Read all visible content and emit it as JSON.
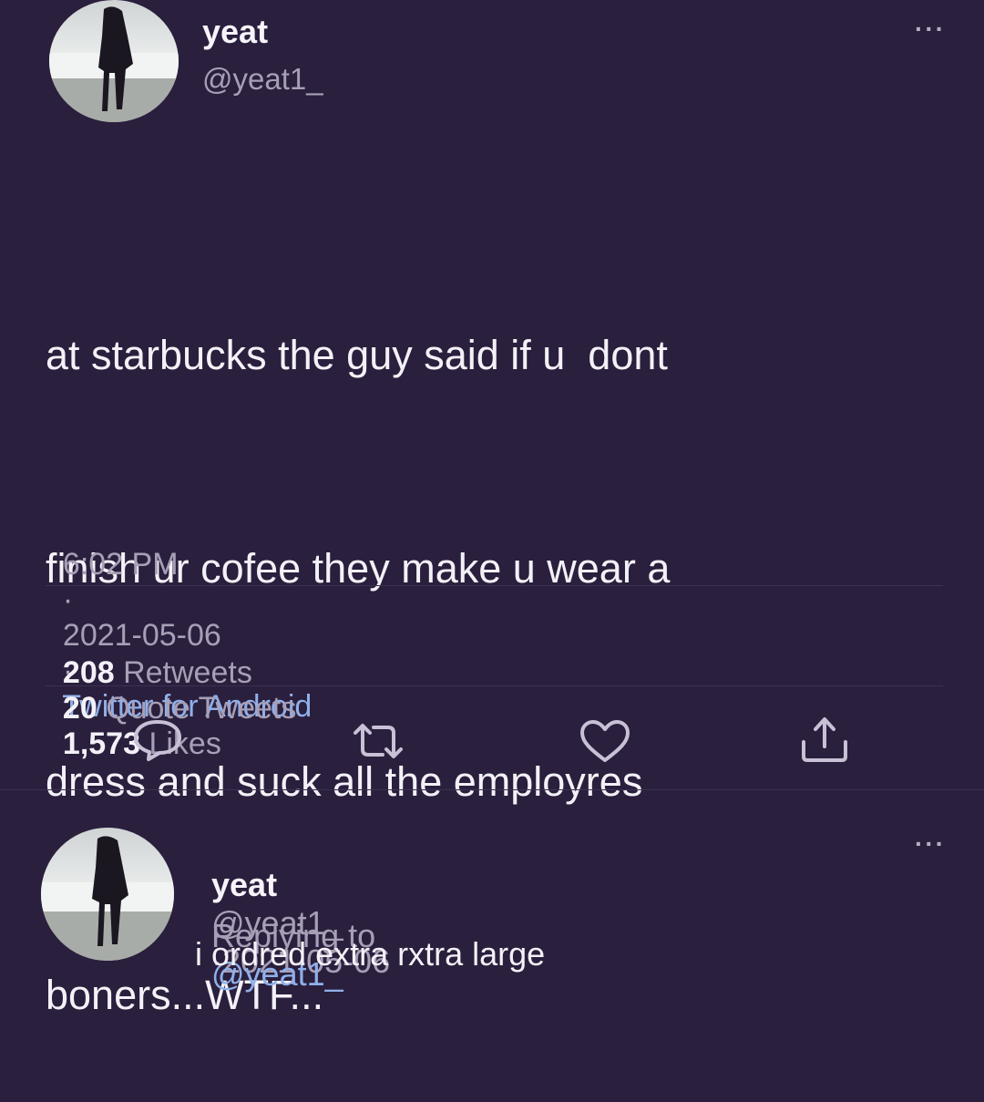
{
  "tweet": {
    "author_name": "yeat",
    "author_handle": "@yeat1_",
    "text_lines": [
      "at starbucks the guy said if u  dont",
      "finish ur cofee they make u wear a",
      "dress and suck all the employres",
      "boners...WTF..."
    ],
    "time": "6:02 PM",
    "separator": "·",
    "date": "2021-05-06",
    "source": "Twitter for Android",
    "stats": {
      "retweets_count": "208",
      "retweets_label": "Retweets",
      "quotes_count": "20",
      "quotes_label": "Quote Tweets",
      "likes_count": "1,573",
      "likes_label": "Likes"
    },
    "more": "···"
  },
  "reply": {
    "author_name": "yeat",
    "author_handle": "@yeat1_",
    "separator": "·",
    "date": "2021-05-06",
    "replying_to_label": "Replying to",
    "replying_to_handle": "@yeat1_",
    "text": "i ordred extra rxtra large",
    "more": "···"
  },
  "icons": [
    "reply-icon",
    "retweet-icon",
    "like-icon",
    "share-icon",
    "more-icon"
  ],
  "colors": {
    "background": "#2a1f3d",
    "text": "#f3f1f7",
    "muted": "#a79fb6",
    "link": "#8fb0ea"
  }
}
